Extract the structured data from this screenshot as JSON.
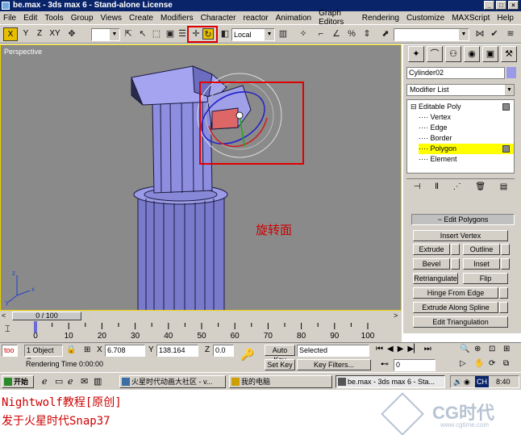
{
  "window": {
    "title": "be.max - 3ds max 6 - Stand-alone License",
    "buttons": {
      "minimize": "_",
      "maximize": "□",
      "close": "×"
    }
  },
  "menu": [
    "File",
    "Edit",
    "Tools",
    "Group",
    "Views",
    "Create",
    "Modifiers",
    "Character",
    "reactor",
    "Animation",
    "Graph Editors",
    "Rendering",
    "Customize",
    "MAXScript",
    "Help"
  ],
  "toolbar": {
    "axis_x": "X",
    "axis_y": "Y",
    "axis_z": "Z",
    "axis_xy": "XY",
    "refcoord": "Local"
  },
  "viewport": {
    "label": "Perspective",
    "annotation": "旋转面",
    "axis_x": "x",
    "axis_y": "y",
    "axis_z": "z"
  },
  "command_panel": {
    "object_name": "Cylinder02",
    "modifier_list": "Modifier List",
    "stack": [
      {
        "label": "Editable Poly",
        "type": "root"
      },
      {
        "label": "Vertex",
        "type": "sub"
      },
      {
        "label": "Edge",
        "type": "sub"
      },
      {
        "label": "Border",
        "type": "sub"
      },
      {
        "label": "Polygon",
        "type": "sub",
        "selected": true
      },
      {
        "label": "Element",
        "type": "sub"
      }
    ],
    "rollout_title": "Edit Polygons",
    "buttons": {
      "insert_vertex": "Insert Vertex",
      "extrude": "Extrude",
      "outline": "Outline",
      "bevel": "Bevel",
      "inset": "Inset",
      "retriangulate": "Retriangulate",
      "flip": "Flip",
      "hinge_from_edge": "Hinge From Edge",
      "extrude_along_spline": "Extrude Along Spline",
      "edit_triangulation": "Edit Triangulation"
    }
  },
  "timeline": {
    "slider_label": "0 / 100",
    "ticks": [
      "0",
      "10",
      "20",
      "30",
      "40",
      "50",
      "60",
      "70",
      "80",
      "90",
      "100"
    ]
  },
  "status": {
    "script_label": "too",
    "selection": "1 Object Se",
    "x_label": "X",
    "x_value": "6.708",
    "y_label": "Y",
    "y_value": "138.164",
    "z_label": "Z",
    "z_value": "0.0",
    "auto_key": "Auto Key",
    "set_key": "Set Key",
    "selected": "Selected",
    "key_filters": "Key Filters...",
    "rendering_time": "Rendering Time  0:00:00",
    "frame": "0"
  },
  "taskbar": {
    "start": "开始",
    "tasks": [
      "火星时代动画大社区 - v...",
      "我的电脑",
      "be.max - 3ds max 6 - Sta..."
    ],
    "clock": "8:40",
    "ime": "CH"
  },
  "captions": {
    "line1": "Nightwolf教程[原创]",
    "line2": "发于火星时代Snap37"
  },
  "watermark": {
    "brand": "CG时代",
    "url": "www.cgtime.com"
  }
}
